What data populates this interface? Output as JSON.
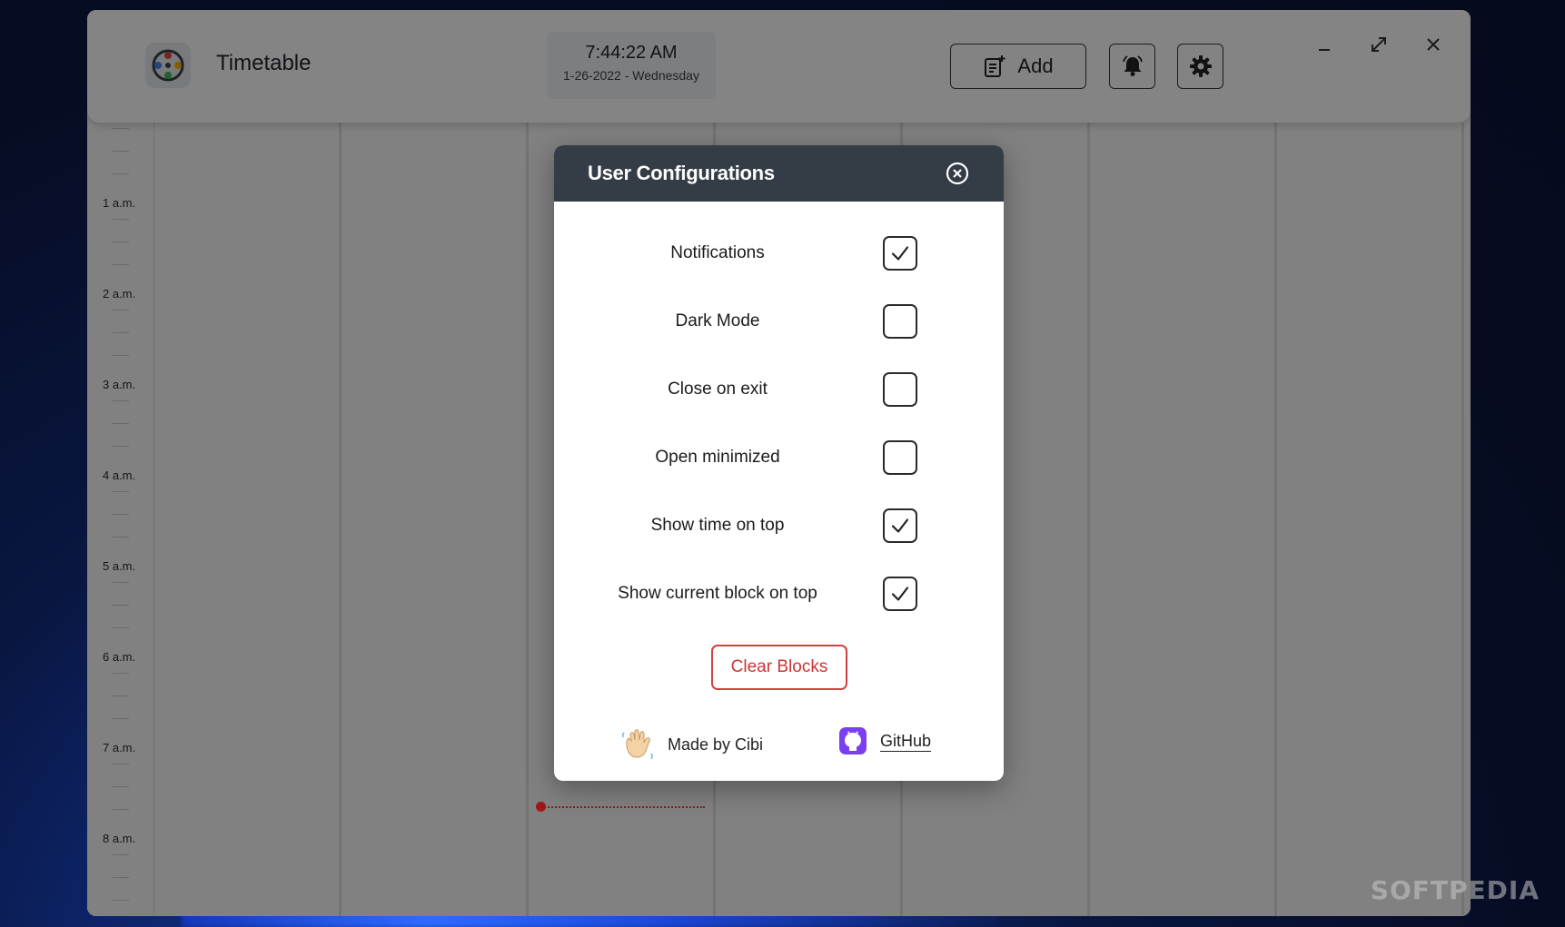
{
  "app": {
    "title": "Timetable",
    "clock_time": "7:44:22 AM",
    "clock_date": "1-26-2022 - Wednesday",
    "add_label": "Add"
  },
  "timeline": {
    "hours": [
      "1 a.m.",
      "2 a.m.",
      "3 a.m.",
      "4 a.m.",
      "5 a.m.",
      "6 a.m.",
      "7 a.m.",
      "8 a.m."
    ]
  },
  "modal": {
    "title": "User Configurations",
    "options": [
      {
        "label": "Notifications",
        "checked": true
      },
      {
        "label": "Dark Mode",
        "checked": false
      },
      {
        "label": "Close on exit",
        "checked": false
      },
      {
        "label": "Open minimized",
        "checked": false
      },
      {
        "label": "Show time on top",
        "checked": true
      },
      {
        "label": "Show current block on top",
        "checked": true
      }
    ],
    "clear_label": "Clear Blocks",
    "made_by": "Made by Cibi",
    "github_label": "GitHub"
  },
  "watermark": "SOFTPEDIA",
  "colors": {
    "header_bg": "#343c46",
    "danger": "#d03434",
    "now_indicator": "#a01818"
  }
}
